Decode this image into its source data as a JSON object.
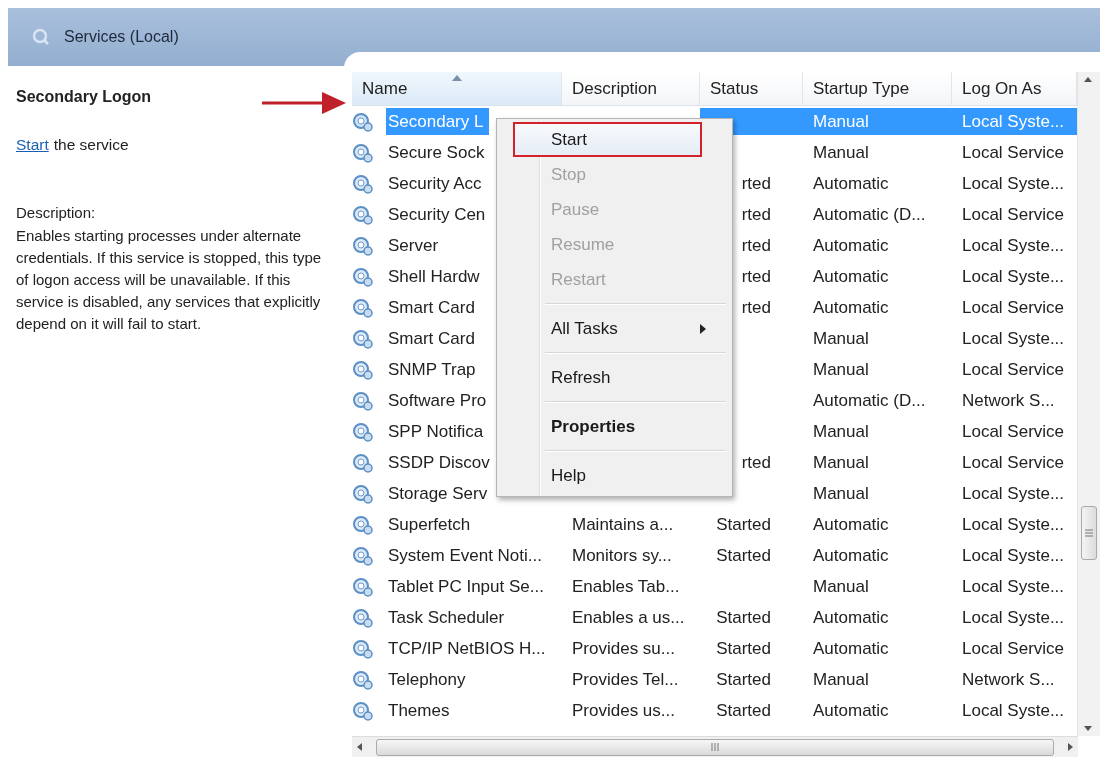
{
  "header": {
    "title": "Services (Local)"
  },
  "details": {
    "service_name": "Secondary Logon",
    "action_link": "Start",
    "action_text": "the service",
    "description_label": "Description:",
    "description": "Enables starting processes under alternate credentials. If this service is stopped, this type of logon access will be unavailable. If this service is disabled, any services that explicitly depend on it will fail to start."
  },
  "table": {
    "columns": [
      {
        "label": "Name",
        "sorted": true
      },
      {
        "label": "Description",
        "sorted": false
      },
      {
        "label": "Status",
        "sorted": false
      },
      {
        "label": "Startup Type",
        "sorted": false
      },
      {
        "label": "Log On As",
        "sorted": false
      }
    ],
    "rows": [
      {
        "name": "Secondary L",
        "startup_type": "Manual",
        "log_on_as": "Local Syste...",
        "selected": true
      },
      {
        "name": "Secure Sock",
        "startup_type": "Manual",
        "log_on_as": "Local Service",
        "selected": false
      },
      {
        "name": "Security Acc",
        "status": "rted",
        "startup_type": "Automatic",
        "log_on_as": "Local Syste...",
        "selected": false
      },
      {
        "name": "Security Cen",
        "status": "rted",
        "startup_type": "Automatic (D...",
        "log_on_as": "Local Service",
        "selected": false
      },
      {
        "name": "Server",
        "status": "rted",
        "startup_type": "Automatic",
        "log_on_as": "Local Syste...",
        "selected": false
      },
      {
        "name": "Shell Hardw",
        "status": "rted",
        "startup_type": "Automatic",
        "log_on_as": "Local Syste...",
        "selected": false
      },
      {
        "name": "Smart Card",
        "status": "rted",
        "startup_type": "Automatic",
        "log_on_as": "Local Service",
        "selected": false
      },
      {
        "name": "Smart Card",
        "startup_type": "Manual",
        "log_on_as": "Local Syste...",
        "selected": false
      },
      {
        "name": "SNMP Trap",
        "startup_type": "Manual",
        "log_on_as": "Local Service",
        "selected": false
      },
      {
        "name": "Software Pro",
        "startup_type": "Automatic (D...",
        "log_on_as": "Network S...",
        "selected": false
      },
      {
        "name": "SPP Notifica",
        "startup_type": "Manual",
        "log_on_as": "Local Service",
        "selected": false
      },
      {
        "name": "SSDP Discov",
        "status": "rted",
        "startup_type": "Manual",
        "log_on_as": "Local Service",
        "selected": false
      },
      {
        "name": "Storage Serv",
        "startup_type": "Manual",
        "log_on_as": "Local Syste...",
        "selected": false
      },
      {
        "name": "Superfetch",
        "description": "Maintains a...",
        "status": "Started",
        "startup_type": "Automatic",
        "log_on_as": "Local Syste...",
        "selected": false
      },
      {
        "name": "System Event Noti...",
        "description": "Monitors sy...",
        "status": "Started",
        "startup_type": "Automatic",
        "log_on_as": "Local Syste...",
        "selected": false
      },
      {
        "name": "Tablet PC Input Se...",
        "description": "Enables Tab...",
        "startup_type": "Manual",
        "log_on_as": "Local Syste...",
        "selected": false
      },
      {
        "name": "Task Scheduler",
        "description": "Enables a us...",
        "status": "Started",
        "startup_type": "Automatic",
        "log_on_as": "Local Syste...",
        "selected": false
      },
      {
        "name": "TCP/IP NetBIOS H...",
        "description": "Provides su...",
        "status": "Started",
        "startup_type": "Automatic",
        "log_on_as": "Local Service",
        "selected": false
      },
      {
        "name": "Telephony",
        "description": "Provides Tel...",
        "status": "Started",
        "startup_type": "Manual",
        "log_on_as": "Network S...",
        "selected": false
      },
      {
        "name": "Themes",
        "description": "Provides us...",
        "status": "Started",
        "startup_type": "Automatic",
        "log_on_as": "Local Syste...",
        "selected": false
      }
    ]
  },
  "context_menu": {
    "items": [
      {
        "kind": "item",
        "label": "Start",
        "disabled": false,
        "bold": false,
        "highlighted": true
      },
      {
        "kind": "item",
        "label": "Stop",
        "disabled": true,
        "bold": false,
        "highlighted": false
      },
      {
        "kind": "item",
        "label": "Pause",
        "disabled": true,
        "bold": false,
        "highlighted": false
      },
      {
        "kind": "item",
        "label": "Resume",
        "disabled": true,
        "bold": false,
        "highlighted": false
      },
      {
        "kind": "item",
        "label": "Restart",
        "disabled": true,
        "bold": false,
        "highlighted": false
      },
      {
        "kind": "separator"
      },
      {
        "kind": "submenu",
        "label": "All Tasks",
        "disabled": false,
        "bold": false,
        "highlighted": false
      },
      {
        "kind": "separator"
      },
      {
        "kind": "item",
        "label": "Refresh",
        "disabled": false,
        "bold": false,
        "highlighted": false
      },
      {
        "kind": "separator"
      },
      {
        "kind": "item",
        "label": "Properties",
        "disabled": false,
        "bold": true,
        "highlighted": false
      },
      {
        "kind": "separator"
      },
      {
        "kind": "item",
        "label": "Help",
        "disabled": false,
        "bold": false,
        "highlighted": false
      }
    ]
  }
}
